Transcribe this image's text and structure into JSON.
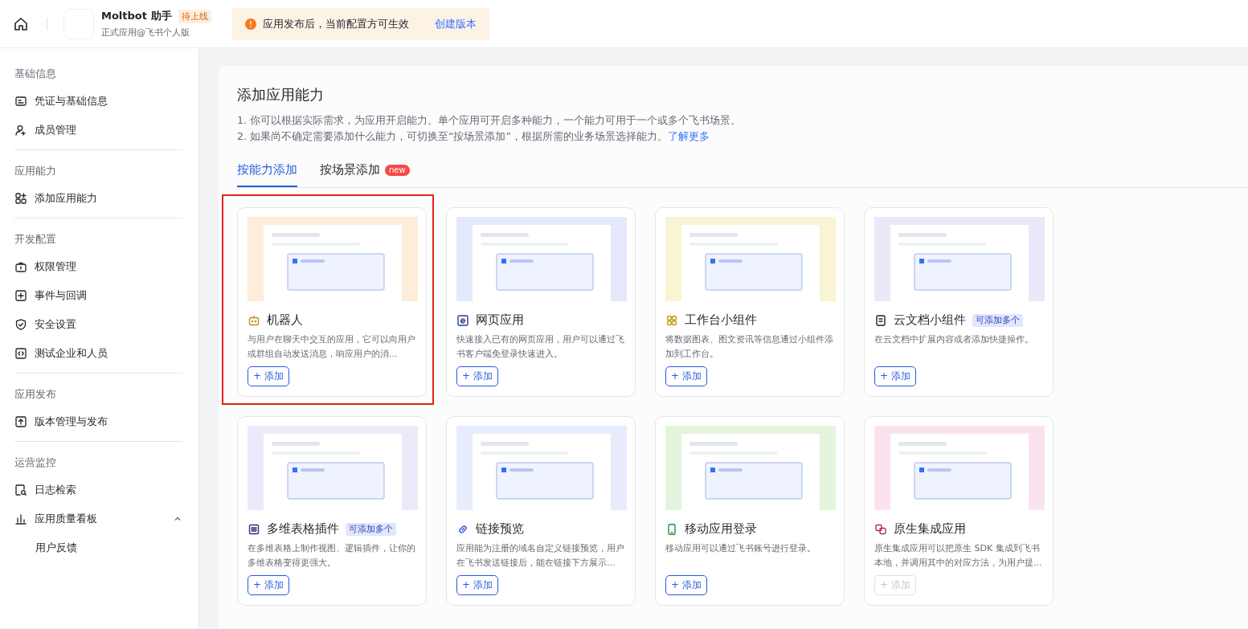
{
  "header": {
    "app_name": "Moltbot 助手",
    "status_badge": "待上线",
    "app_type": "正式应用@飞书个人版",
    "notice": {
      "text": "应用发布后，当前配置方可生效",
      "link": "创建版本"
    }
  },
  "sidebar": {
    "sections": [
      {
        "title": "基础信息",
        "items": [
          {
            "label": "凭证与基础信息"
          },
          {
            "label": "成员管理"
          }
        ]
      },
      {
        "title": "应用能力",
        "items": [
          {
            "label": "添加应用能力"
          }
        ]
      },
      {
        "title": "开发配置",
        "items": [
          {
            "label": "权限管理"
          },
          {
            "label": "事件与回调"
          },
          {
            "label": "安全设置"
          },
          {
            "label": "测试企业和人员"
          }
        ]
      },
      {
        "title": "应用发布",
        "items": [
          {
            "label": "版本管理与发布"
          }
        ]
      },
      {
        "title": "运营监控",
        "items": [
          {
            "label": "日志检索"
          },
          {
            "label": "应用质量看板",
            "expanded": true,
            "children": [
              {
                "label": "用户反馈"
              }
            ]
          }
        ]
      }
    ]
  },
  "main": {
    "title": "添加应用能力",
    "notes": [
      "1. 你可以根据实际需求，为应用开启能力。单个应用可开启多种能力，一个能力可用于一个或多个飞书场景。",
      "2. 如果尚不确定需要添加什么能力，可切换至“按场景添加”，根据所需的业务场景选择能力。"
    ],
    "learn_more": "了解更多",
    "tabs": [
      {
        "label": "按能力添加",
        "selected": true
      },
      {
        "label": "按场景添加",
        "selected": false,
        "badge": "new"
      }
    ],
    "cards": [
      {
        "title": "机器人",
        "description": "与用户在聊天中交互的应用，它可以向用户或群组自动发送消息，响应用户的消...",
        "button": "+ 添加",
        "disabled": false,
        "highlighted": true
      },
      {
        "title": "网页应用",
        "description": "快速接入已有的网页应用，用户可以通过飞书客户端免登录快速进入。",
        "button": "+ 添加",
        "disabled": false,
        "highlighted": false
      },
      {
        "title": "工作台小组件",
        "description": "将数据图表、图文资讯等信息通过小组件添加到工作台。",
        "button": "+ 添加",
        "disabled": false,
        "highlighted": false
      },
      {
        "title": "云文档小组件",
        "badge": "可添加多个",
        "description": "在云文档中扩展内容或者添加快捷操作。",
        "button": "+ 添加",
        "disabled": false,
        "highlighted": false
      },
      {
        "title": "多维表格插件",
        "badge": "可添加多个",
        "description": "在多维表格上制作视图、逻辑插件，让你的多维表格变得更强大。",
        "button": "+ 添加",
        "disabled": false,
        "highlighted": false
      },
      {
        "title": "链接预览",
        "description": "应用能为注册的域名自定义链接预览，用户在飞书发送链接后，能在链接下方展示...",
        "button": "+ 添加",
        "disabled": false,
        "highlighted": false
      },
      {
        "title": "移动应用登录",
        "description": "移动应用可以通过飞书账号进行登录。",
        "button": "+ 添加",
        "disabled": false,
        "highlighted": false
      },
      {
        "title": "原生集成应用",
        "description": "原生集成应用可以把原生 SDK 集成到飞书本地，并调用其中的对应方法，为用户提...",
        "button": "+ 添加",
        "disabled": true,
        "highlighted": false
      }
    ]
  }
}
